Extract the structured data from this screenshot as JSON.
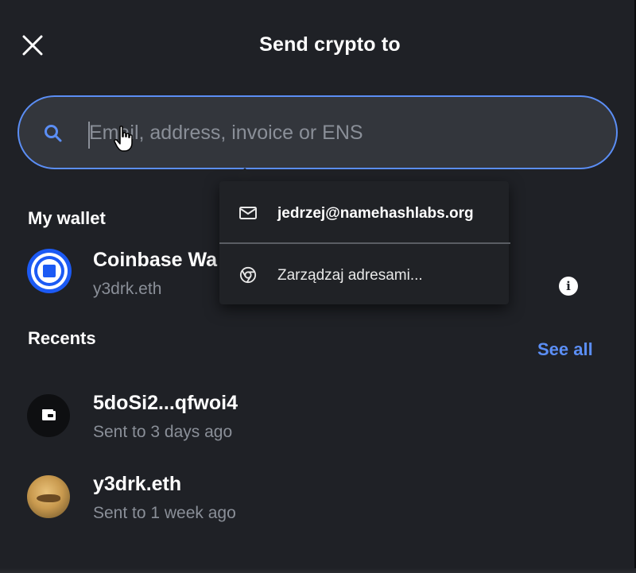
{
  "header": {
    "title": "Send crypto to"
  },
  "search": {
    "placeholder": "Email, address, invoice or ENS",
    "value": ""
  },
  "autofill": {
    "items": [
      {
        "label": "jedrzej@namehashlabs.org",
        "icon": "mail-icon"
      },
      {
        "label": "Zarządzaj adresami...",
        "icon": "chrome-icon"
      }
    ]
  },
  "my_wallet": {
    "section_label": "My wallet",
    "name": "Coinbase Wa",
    "subtitle": "y3drk.eth"
  },
  "recents": {
    "section_label": "Recents",
    "see_all_label": "See all",
    "items": [
      {
        "title": "5doSi2...qfwoi4",
        "subtitle": "Sent to 3 days ago"
      },
      {
        "title": "y3drk.eth",
        "subtitle": "Sent to 1 week ago"
      }
    ]
  },
  "colors": {
    "background": "#1f2126",
    "accent": "#5b8ef5",
    "input_background": "#33363c",
    "muted_text": "#8a8f98",
    "coinbase_blue": "#1c5af4"
  }
}
